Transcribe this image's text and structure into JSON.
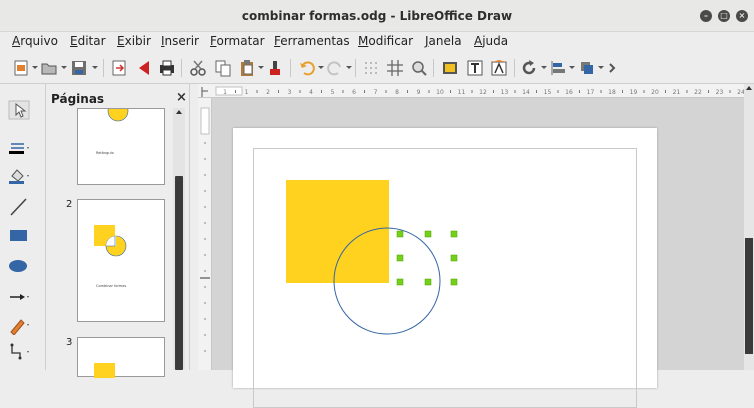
{
  "window": {
    "title": "combinar formas.odg - LibreOffice Draw"
  },
  "menu": [
    "Arquivo",
    "Editar",
    "Exibir",
    "Inserir",
    "Formatar",
    "Ferramentas",
    "Modificar",
    "Janela",
    "Ajuda"
  ],
  "pages_panel": {
    "title": "Páginas",
    "close": "×",
    "thumbs": [
      {
        "number": "",
        "caption": "Retângulo"
      },
      {
        "number": "2",
        "caption": "Combinar formas"
      },
      {
        "number": "3",
        "caption": ""
      }
    ]
  },
  "colors": {
    "shape_fill": "#ffd220",
    "circle_stroke": "#3465a4",
    "handle": "#73d216",
    "accent": "#3b3b3b"
  },
  "hruler_labels": [
    "1",
    "1",
    "2",
    "3",
    "4",
    "5",
    "6",
    "7",
    "8",
    "9",
    "10",
    "11",
    "12",
    "13",
    "14",
    "15",
    "16",
    "17",
    "18",
    "19",
    "20",
    "21",
    "22",
    "23",
    "24"
  ]
}
